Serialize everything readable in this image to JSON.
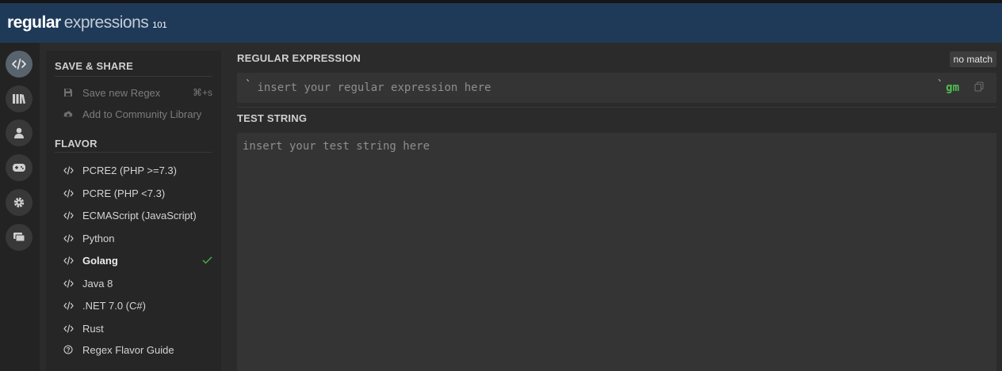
{
  "app": {
    "logo_word1": "regular",
    "logo_word2": "expressions",
    "logo_suffix": "101"
  },
  "iconbar": [
    {
      "name": "code-icon",
      "active": true
    },
    {
      "name": "library-icon",
      "active": false
    },
    {
      "name": "user-icon",
      "active": false
    },
    {
      "name": "gamepad-icon",
      "active": false
    },
    {
      "name": "gear-icon",
      "active": false
    },
    {
      "name": "chat-icon",
      "active": false
    }
  ],
  "save_share": {
    "title": "SAVE & SHARE",
    "save_label": "Save new Regex",
    "save_shortcut": "⌘+s",
    "community_label": "Add to Community Library"
  },
  "flavor": {
    "title": "FLAVOR",
    "items": [
      {
        "label": "PCRE2 (PHP >=7.3)",
        "selected": false
      },
      {
        "label": "PCRE (PHP <7.3)",
        "selected": false
      },
      {
        "label": "ECMAScript (JavaScript)",
        "selected": false
      },
      {
        "label": "Python",
        "selected": false
      },
      {
        "label": "Golang",
        "selected": true
      },
      {
        "label": "Java 8",
        "selected": false
      },
      {
        "label": ".NET 7.0 (C#)",
        "selected": false
      },
      {
        "label": "Rust",
        "selected": false
      }
    ],
    "guide_label": "Regex Flavor Guide"
  },
  "regex": {
    "label": "REGULAR EXPRESSION",
    "placeholder": "insert your regular expression here",
    "value": "",
    "delimiter": "`",
    "flags": "gm",
    "match_status": "no match"
  },
  "test": {
    "label": "TEST STRING",
    "placeholder": "insert your test string here",
    "value": ""
  },
  "colors": {
    "header_bg": "#1f3a58",
    "flags": "#4fc04f",
    "check": "#4caf50"
  }
}
